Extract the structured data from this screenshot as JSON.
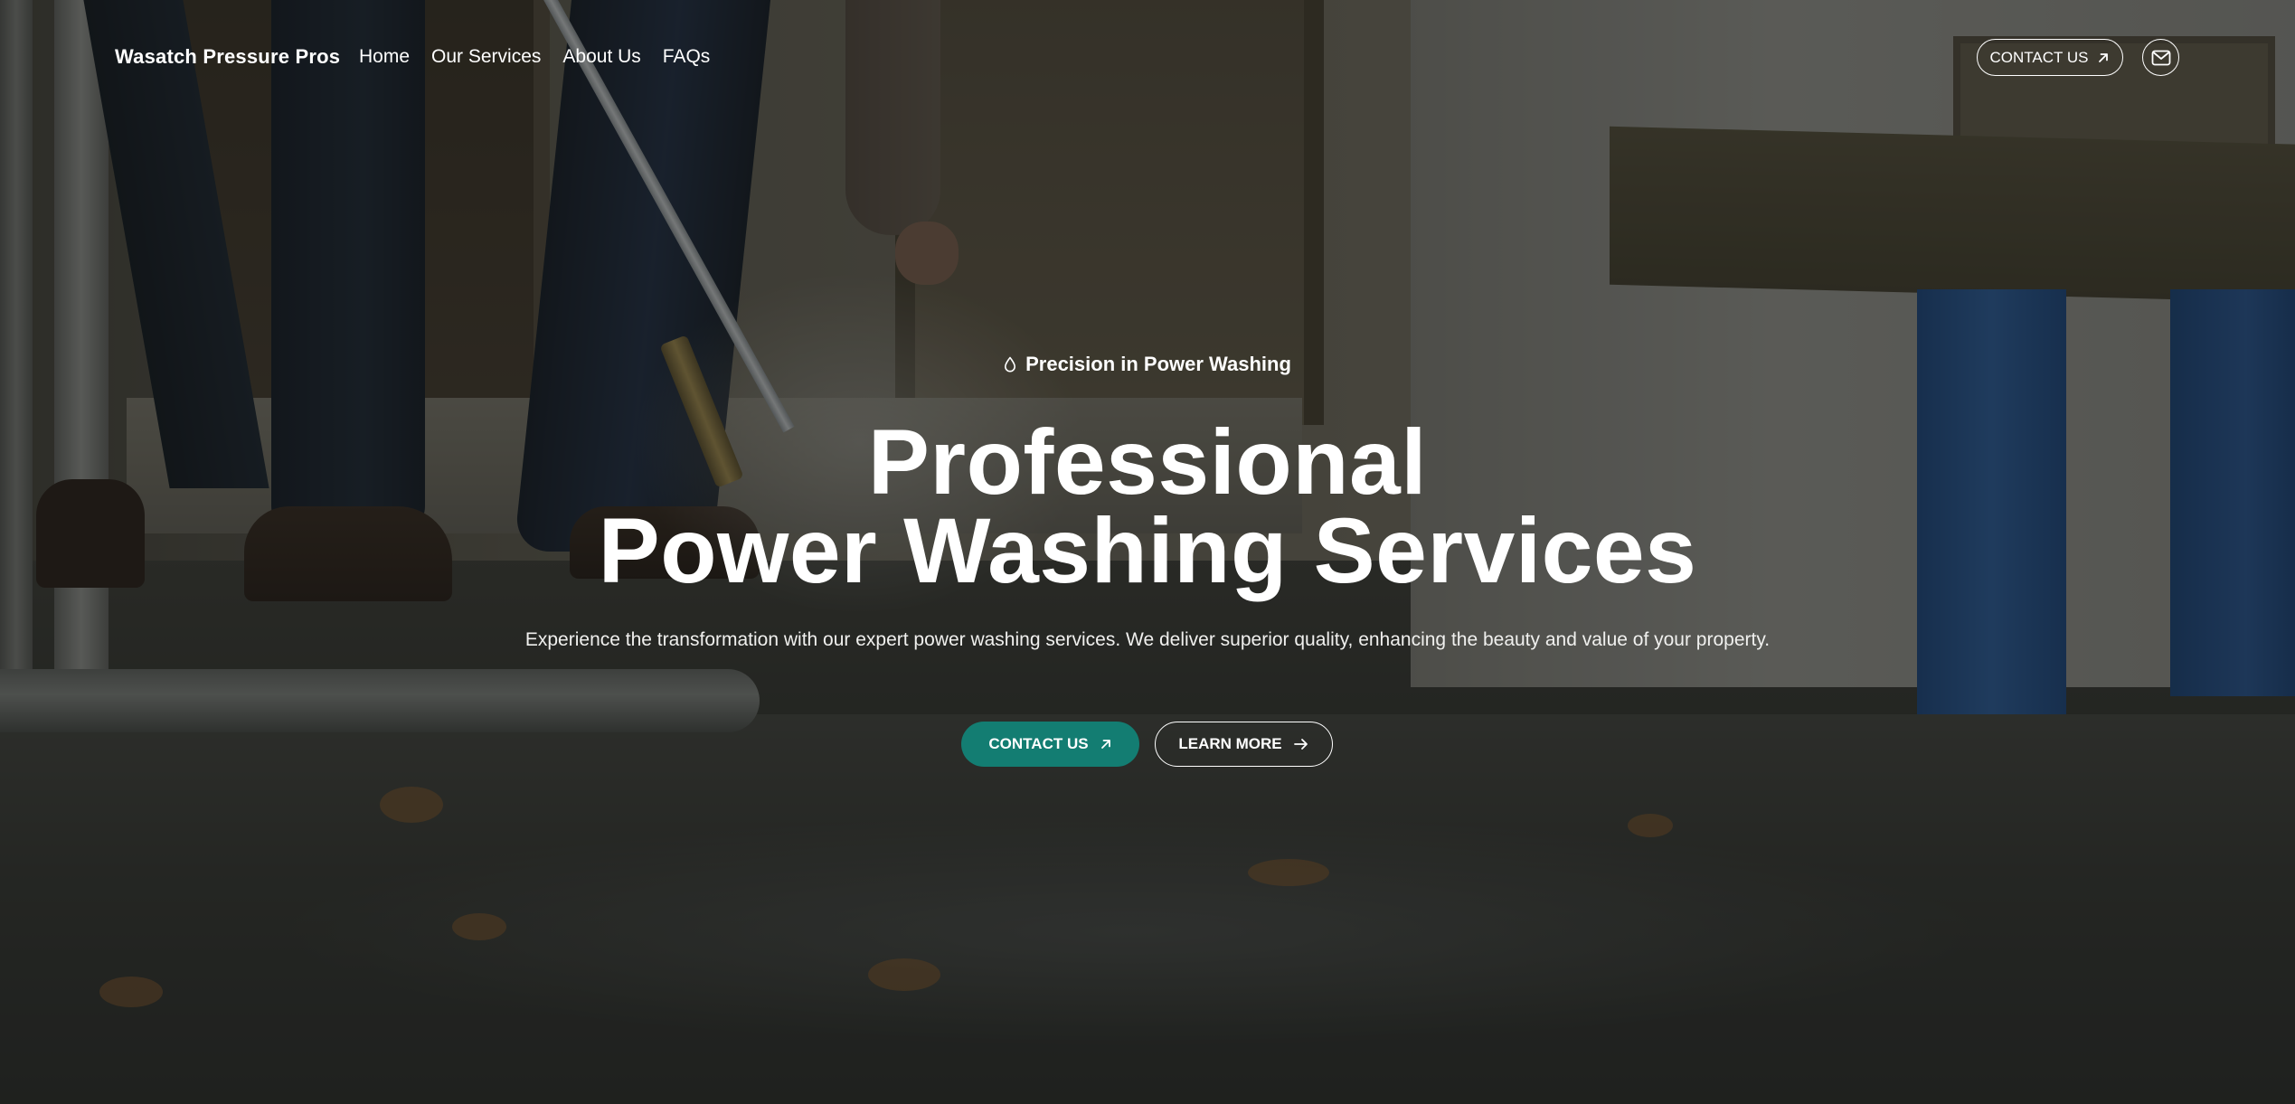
{
  "header": {
    "brand": "Wasatch Pressure Pros",
    "nav": [
      {
        "label": "Home"
      },
      {
        "label": "Our Services"
      },
      {
        "label": "About Us"
      },
      {
        "label": "FAQs"
      }
    ],
    "contact_label": "CONTACT US",
    "contact_icon": "arrow-up-right-icon",
    "mail_icon": "mail-icon"
  },
  "hero": {
    "eyebrow_icon": "water-drop-icon",
    "eyebrow": "Precision in Power Washing",
    "title_line1": "Professional",
    "title_line2": "Power Washing Services",
    "subtitle": "Experience the transformation with our expert power washing services. We deliver superior quality, enhancing the beauty and value of your property.",
    "primary_cta": "CONTACT US",
    "primary_cta_icon": "arrow-up-right-icon",
    "secondary_cta": "LEARN MORE",
    "secondary_cta_icon": "arrow-right-icon"
  },
  "colors": {
    "accent": "#137d72",
    "text": "#ffffff"
  }
}
